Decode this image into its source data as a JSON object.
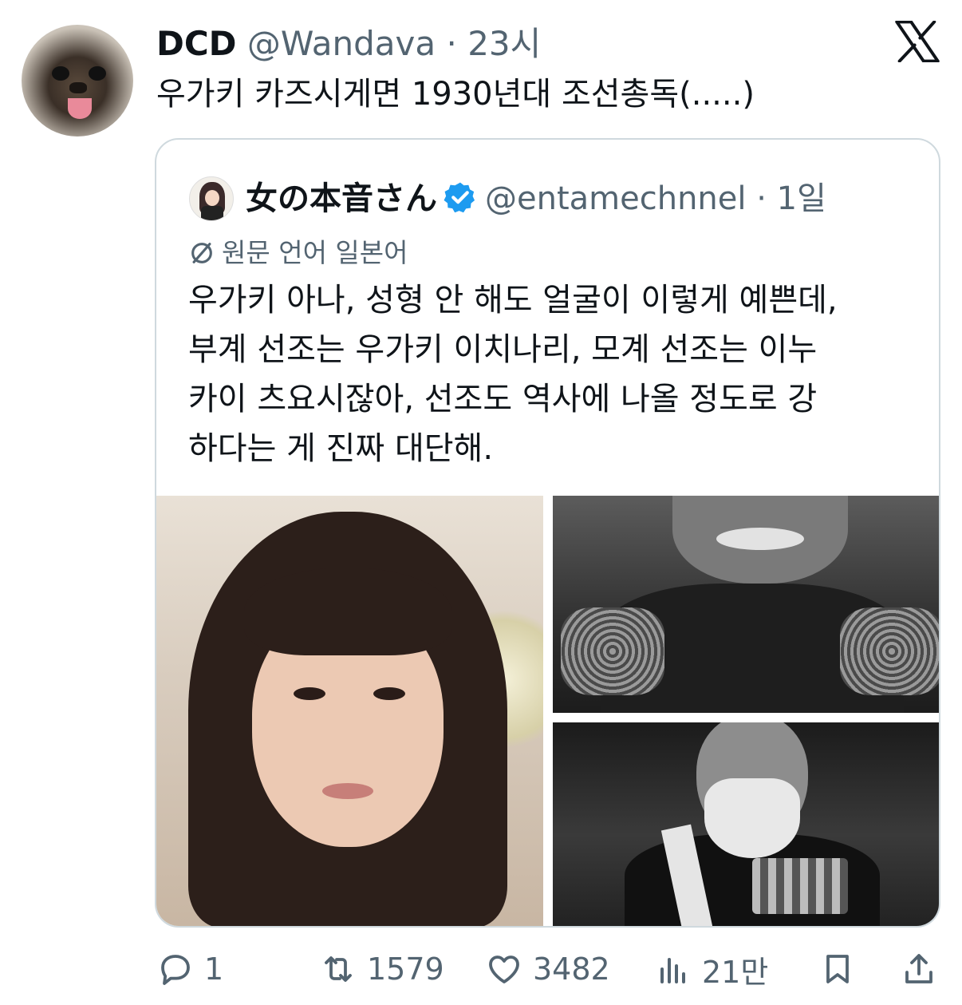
{
  "author": {
    "name": "DCD",
    "handle": "@Wandava",
    "separator": "·",
    "time": "23시"
  },
  "tweet": {
    "text": "우가키 카즈시게면 1930년대 조선총독(.....)"
  },
  "quoted": {
    "name": "女の本音さん",
    "handle": "@entamechnnel",
    "separator": "·",
    "time": "1일",
    "translation_note": "원문 언어 일본어",
    "lines": [
      "우가키 아나, 성형 안 해도 얼굴이 이렇게 예쁜데,",
      "부계 선조는 우가키 이치나리, 모계 선조는 이누",
      "카이 츠요시잖아, 선조도 역사에 나올 정도로 강",
      "하다는 게 진짜 대단해."
    ]
  },
  "actions": {
    "replies": "1",
    "retweets": "1579",
    "likes": "3482",
    "views": "21만"
  },
  "icons": {
    "platform": "x-logo-icon",
    "verified": "verified-badge-icon",
    "translate": "translate-icon",
    "reply": "reply-icon",
    "retweet": "retweet-icon",
    "like": "heart-icon",
    "views": "views-icon",
    "bookmark": "bookmark-icon",
    "share": "share-icon"
  },
  "colors": {
    "text": "#0f1419",
    "secondary": "#536471",
    "border": "#cfd9de",
    "verified": "#1d9bf0"
  }
}
